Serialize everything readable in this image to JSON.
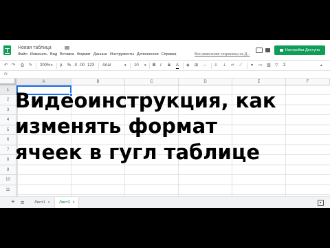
{
  "title_bar": {
    "doc_title": "Новая таблица",
    "save_status": "Все изменения сохранены на Д...",
    "share_label": "Настройки Доступа"
  },
  "menu": [
    "Файл",
    "Изменить",
    "Вид",
    "Вставка",
    "Формат",
    "Данные",
    "Инструменты",
    "Дополнения",
    "Справка"
  ],
  "toolbar": {
    "zoom": "200%",
    "currency": "р.",
    "percent": "%",
    "decimal_less": ".0",
    "decimal_more": ".00",
    "more_formats": "123",
    "font": "Arial",
    "font_size": "10",
    "bold": "B",
    "italic": "I",
    "strike": "S",
    "text_color": "A"
  },
  "formula_bar": {
    "fx": "fx"
  },
  "grid": {
    "columns": [
      "A",
      "B",
      "C",
      "D",
      "E",
      "F"
    ],
    "rows": [
      "1",
      "2",
      "3",
      "4",
      "5",
      "6",
      "7",
      "8",
      "9",
      "10",
      "11"
    ]
  },
  "caption": [
    "Видеоинструкция, как",
    "изменять формат",
    "ячеек в гугл таблице"
  ],
  "sheets": {
    "add": "+",
    "list": "≡",
    "tabs": [
      "Лист1",
      "Лист2"
    ],
    "active_tab": "Лист2"
  },
  "colors": {
    "brand_green": "#0f9d58",
    "selection_blue": "#1a73e8",
    "active_sheet_green": "#188038"
  },
  "icons": [
    "sheets-logo-icon",
    "folder-icon",
    "comment-icon",
    "lock-icon",
    "undo-icon",
    "redo-icon",
    "print-icon",
    "paint-format-icon",
    "explore-icon"
  ]
}
